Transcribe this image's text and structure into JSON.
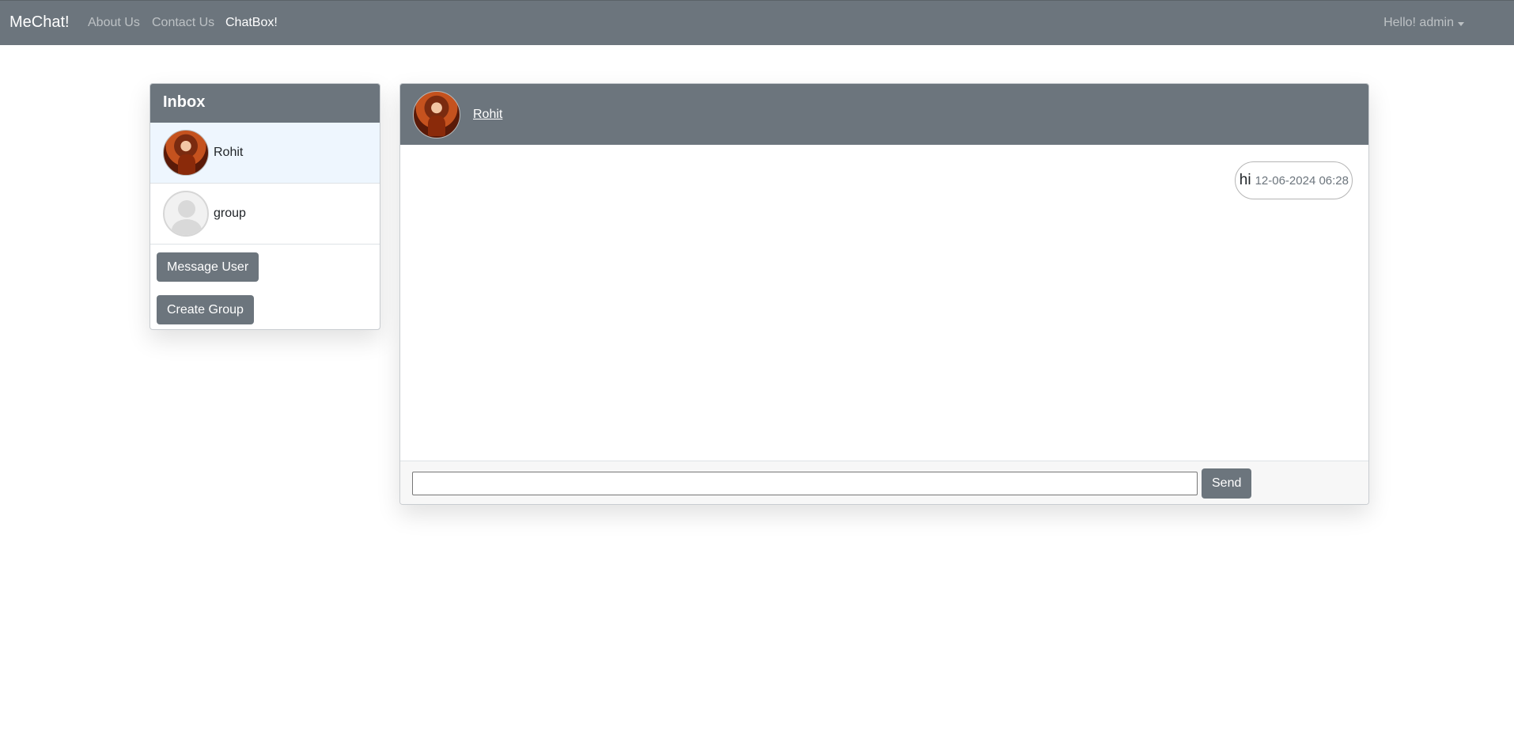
{
  "navbar": {
    "brand": "MeChat!",
    "links": [
      {
        "label": "About Us"
      },
      {
        "label": "Contact Us"
      },
      {
        "label": "ChatBox!"
      }
    ],
    "user_menu": "Hello! admin"
  },
  "inbox": {
    "title": "Inbox",
    "contacts": [
      {
        "name": "Rohit",
        "avatar": "photo-avatar",
        "selected": true
      },
      {
        "name": "group",
        "avatar": "default-avatar",
        "selected": false
      }
    ],
    "message_user_label": "Message User",
    "create_group_label": "Create Group"
  },
  "chat": {
    "recipient": "Rohit",
    "messages": [
      {
        "text": "hi",
        "time": "12-06-2024 06:28"
      }
    ],
    "input_value": "",
    "send_label": "Send"
  },
  "colors": {
    "navbar": "#6c757d",
    "selected_row": "#eef6fe",
    "button": "#6c757d"
  }
}
